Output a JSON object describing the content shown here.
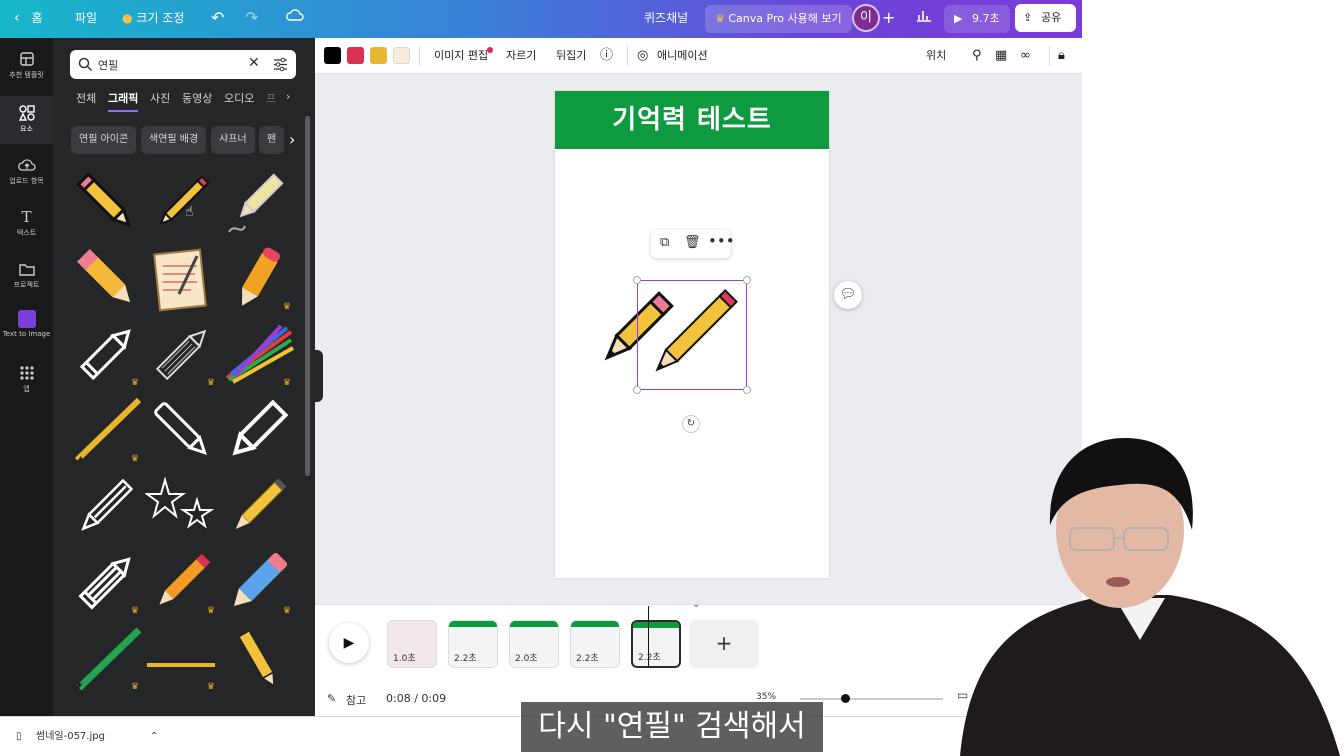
{
  "topbar": {
    "home": "홈",
    "file": "파일",
    "resize": "크기 조정",
    "project_name": "퀴즈채널",
    "pro_cta": "Canva Pro 사용해 보기",
    "avatar_letter": "이",
    "play_duration": "9.7초",
    "share": "공유"
  },
  "rail": {
    "items": [
      {
        "label": "추천 템플릿",
        "icon": "template-icon"
      },
      {
        "label": "요소",
        "icon": "elements-icon"
      },
      {
        "label": "업로드 항목",
        "icon": "upload-icon"
      },
      {
        "label": "텍스트",
        "icon": "text-icon"
      },
      {
        "label": "프로젝트",
        "icon": "folder-icon"
      },
      {
        "label": "Text to Image",
        "icon": "text-to-image-icon"
      },
      {
        "label": "앱",
        "icon": "apps-icon"
      }
    ]
  },
  "panel": {
    "search_value": "연필",
    "tabs": [
      "전체",
      "그래픽",
      "사진",
      "동영상",
      "오디오",
      "프"
    ],
    "active_tab": "그래픽",
    "chips": [
      "연필 아이콘",
      "색연필 배경",
      "샤프너",
      "펜"
    ]
  },
  "toolbar": {
    "colors": [
      "#000000",
      "#d9304f",
      "#e8b835",
      "#f6ebdc"
    ],
    "edit_image": "이미지 편집",
    "crop": "자르기",
    "flip": "뒤집기",
    "animate": "애니메이션",
    "position": "위치"
  },
  "canvas": {
    "banner_title": "기억력 테스트",
    "banner_color": "#0e9a3e"
  },
  "timeline": {
    "clips": [
      {
        "duration": "1.0초"
      },
      {
        "duration": "2.2초"
      },
      {
        "duration": "2.0초"
      },
      {
        "duration": "2.2초"
      },
      {
        "duration": "2.2초"
      }
    ],
    "notes": "참고",
    "time": "0:08 / 0:09",
    "zoom": "35%"
  },
  "download": {
    "file": "썸네일-057.jpg"
  },
  "caption": "다시 \"연필\" 검색해서"
}
